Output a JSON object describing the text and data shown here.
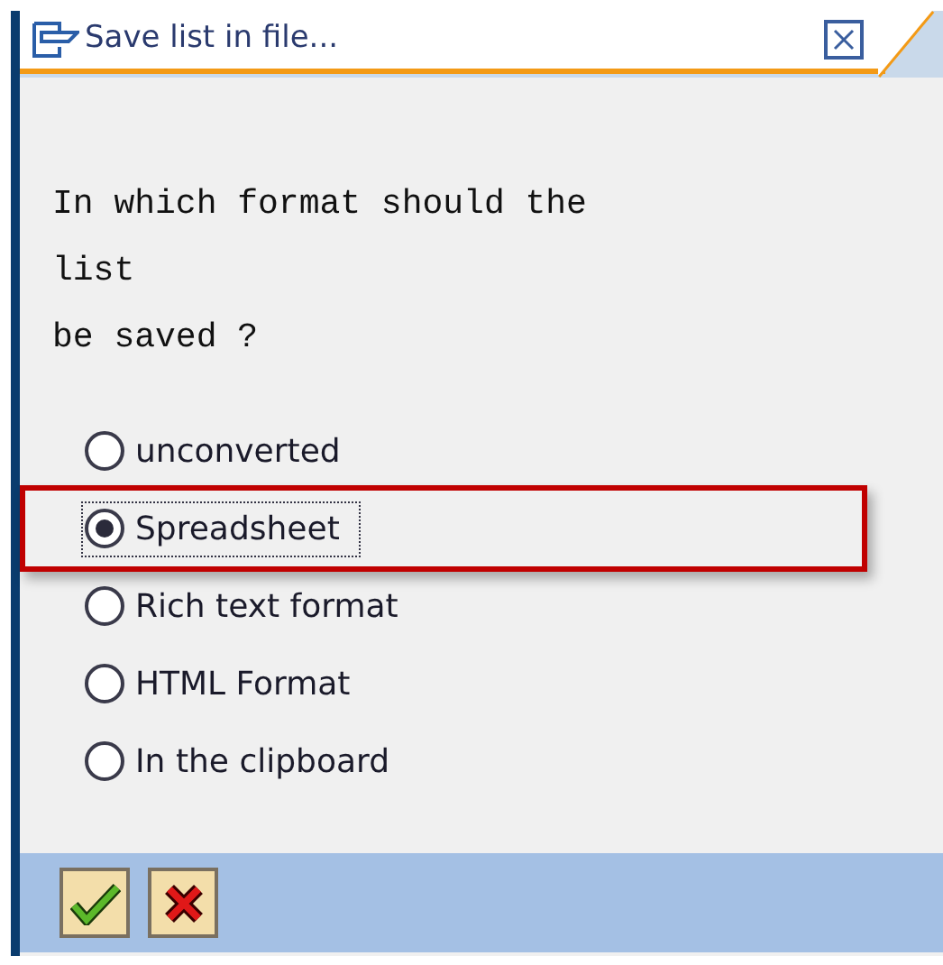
{
  "window": {
    "title": "Save list in file..."
  },
  "message_lines": [
    "In which format should the",
    "list",
    "be saved ?"
  ],
  "options": [
    {
      "label": "unconverted",
      "selected": false,
      "highlighted": false
    },
    {
      "label": "Spreadsheet",
      "selected": true,
      "highlighted": true
    },
    {
      "label": "Rich text format",
      "selected": false,
      "highlighted": false
    },
    {
      "label": "HTML Format",
      "selected": false,
      "highlighted": false
    },
    {
      "label": "In the clipboard",
      "selected": false,
      "highlighted": false
    }
  ],
  "buttons": [
    {
      "kind": "confirm"
    },
    {
      "kind": "cancel"
    }
  ]
}
